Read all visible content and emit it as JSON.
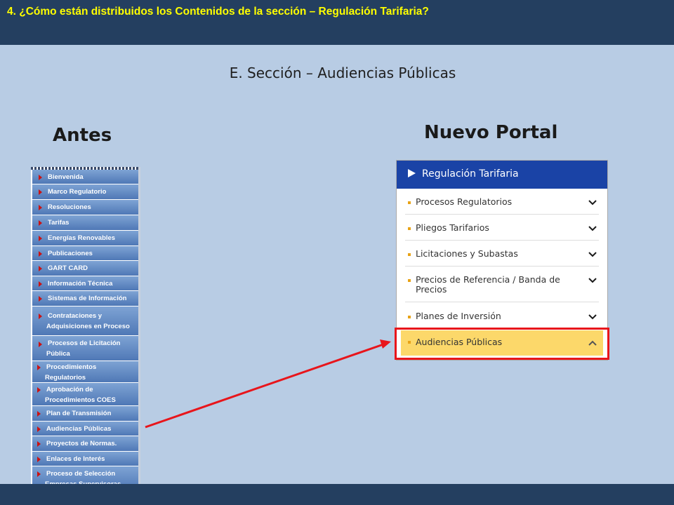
{
  "header": {
    "title": "4. ¿Cómo están distribuidos los Contenidos de la sección –   Regulación Tarifaria?"
  },
  "section_heading": "E. Sección – Audiencias Públicas",
  "labels": {
    "before": "Antes",
    "new_portal": "Nuevo Portal"
  },
  "old_menu": {
    "items": [
      {
        "line1": "Bienvenida"
      },
      {
        "line1": "Marco Regulatorio"
      },
      {
        "line1": "Resoluciones"
      },
      {
        "line1": "Tarifas"
      },
      {
        "line1": "Energías Renovables"
      },
      {
        "line1": "Publicaciones"
      },
      {
        "line1": "GART CARD"
      },
      {
        "line1": "Información Técnica"
      },
      {
        "line1": "Sistemas de Información"
      },
      {
        "line1": "Contrataciones y",
        "line2": "Adquisiciones en Proceso"
      },
      {
        "line1": "Procesos de Licitación",
        "line2": "Pública"
      },
      {
        "line1": "Procedimientos",
        "line2": "Regulatorios"
      },
      {
        "line1": "Aprobación de",
        "line2": "Procedimientos COES"
      },
      {
        "line1": "Plan de Transmisión"
      },
      {
        "line1": "Audiencias Públicas"
      },
      {
        "line1": "Proyectos de Normas."
      },
      {
        "line1": "Enlaces de Interés"
      },
      {
        "line1": "Proceso de Selección",
        "line2": "Empresas Supervisoras"
      }
    ]
  },
  "new_menu": {
    "title": "Regulación Tarifaria",
    "items": [
      {
        "label": "Procesos Regulatorios",
        "chevron": "chevron-down-icon"
      },
      {
        "label": "Pliegos Tarifarios",
        "chevron": "chevron-down-icon"
      },
      {
        "label": "Licitaciones y Subastas",
        "chevron": "chevron-down-icon"
      },
      {
        "label": "Precios de Referencia / Banda de Precios",
        "chevron": "chevron-down-icon"
      },
      {
        "label": "Planes de Inversión",
        "chevron": "chevron-down-icon"
      },
      {
        "label": "Audiencias Públicas",
        "chevron": "chevron-up-icon",
        "active": true
      }
    ]
  },
  "colors": {
    "header_bg": "#243f60",
    "header_text": "#ffff00",
    "page_bg": "#b8cce4",
    "new_menu_header": "#1a43a6",
    "bullet": "#e8a317",
    "active_item": "#fcd86a",
    "highlight": "#e8151b"
  }
}
